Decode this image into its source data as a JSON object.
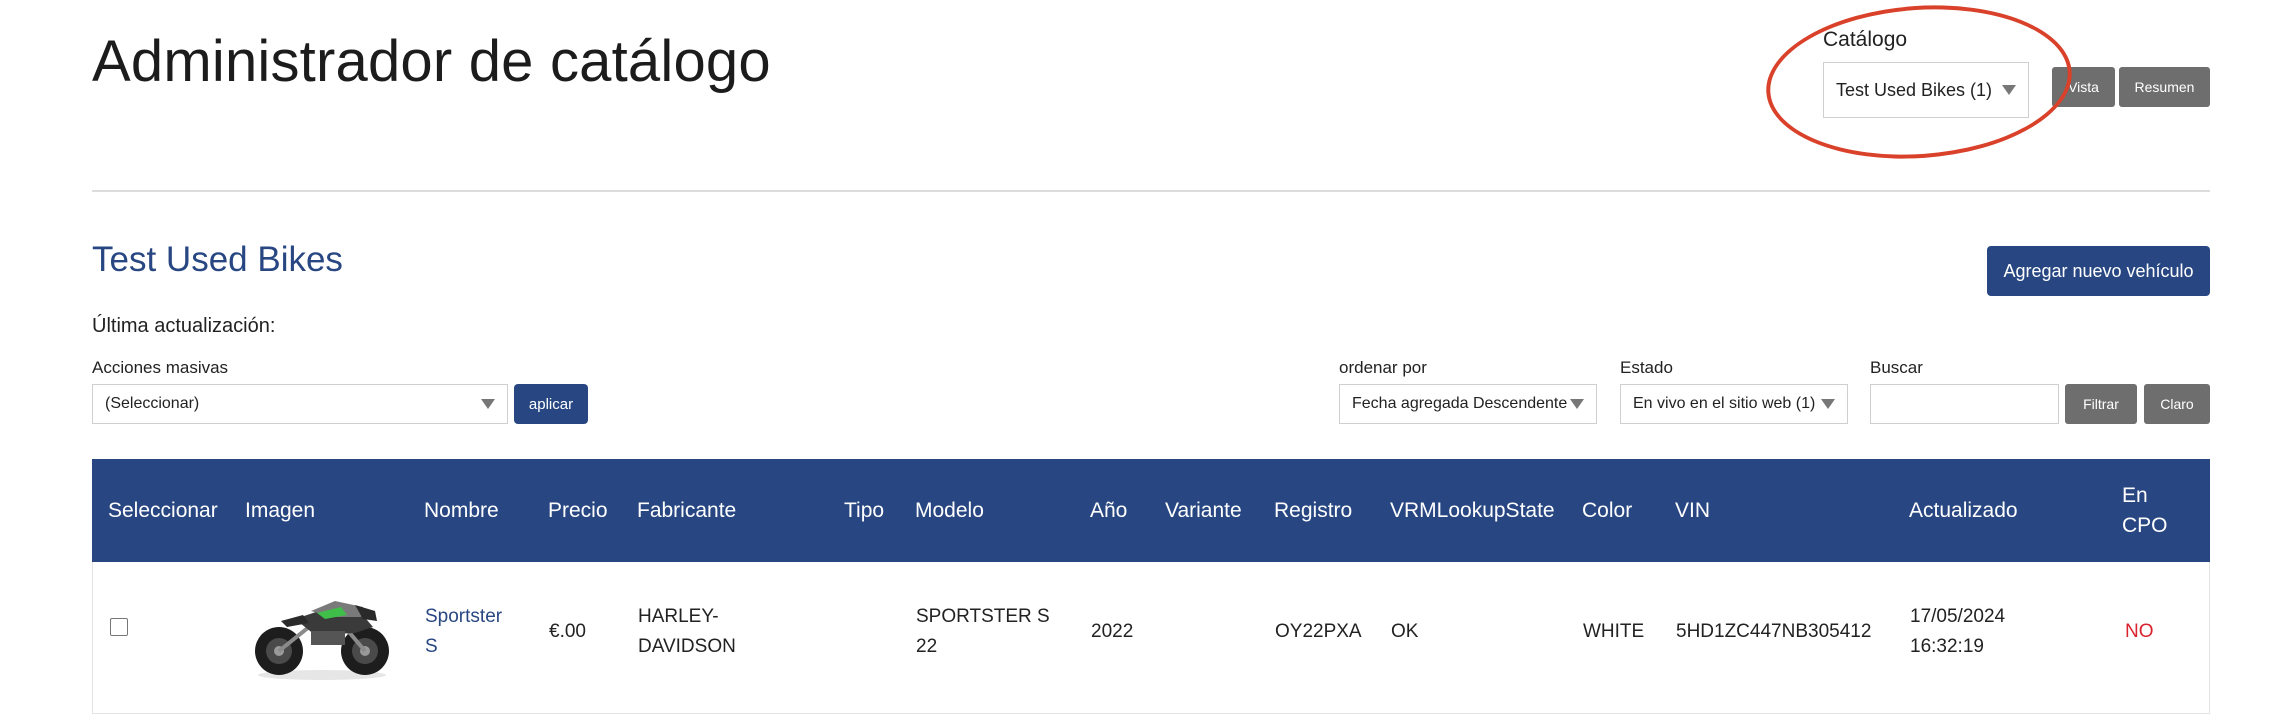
{
  "header": {
    "title": "Administrador de catálogo",
    "catalog_label": "Catálogo",
    "catalog_selected": "Test Used Bikes (1)",
    "view_button": "Vista",
    "summary_button": "Resumen"
  },
  "section": {
    "title": "Test Used Bikes",
    "add_button": "Agregar nuevo vehículo",
    "last_update_label": "Última actualización:"
  },
  "filters": {
    "bulk_label": "Acciones masivas",
    "bulk_selected": "(Seleccionar)",
    "apply_button": "aplicar",
    "sort_label": "ordenar por",
    "sort_selected": "Fecha agregada Descendente",
    "state_label": "Estado",
    "state_selected": "En vivo en el sitio web (1)",
    "search_label": "Buscar",
    "search_value": "",
    "filter_button": "Filtrar",
    "clear_button": "Claro"
  },
  "table": {
    "columns": [
      "Seleccionar",
      "Imagen",
      "Nombre",
      "Precio",
      "Fabricante",
      "Tipo",
      "Modelo",
      "Año",
      "Variante",
      "Registro",
      "VRMLookupState",
      "Color",
      "VIN",
      "Actualizado",
      "En",
      "CPO"
    ],
    "rows": [
      {
        "name_line1": "Sportster",
        "name_line2": "S",
        "price": "€.00",
        "maker_line1": "HARLEY-",
        "maker_line2": "DAVIDSON",
        "type": "",
        "model_line1": "SPORTSTER S",
        "model_line2": "22",
        "year": "2022",
        "variant": "",
        "registration": "OY22PXA",
        "vrm_state": "OK",
        "color": "WHITE",
        "vin": "5HD1ZC447NB305412",
        "updated_line1": "17/05/2024",
        "updated_line2": "16:32:19",
        "cpo": "NO"
      }
    ]
  },
  "colors": {
    "primary": "#284782",
    "gray_button": "#6e6e6e",
    "highlight_circle": "#d9412a",
    "negative": "#d9232e"
  }
}
